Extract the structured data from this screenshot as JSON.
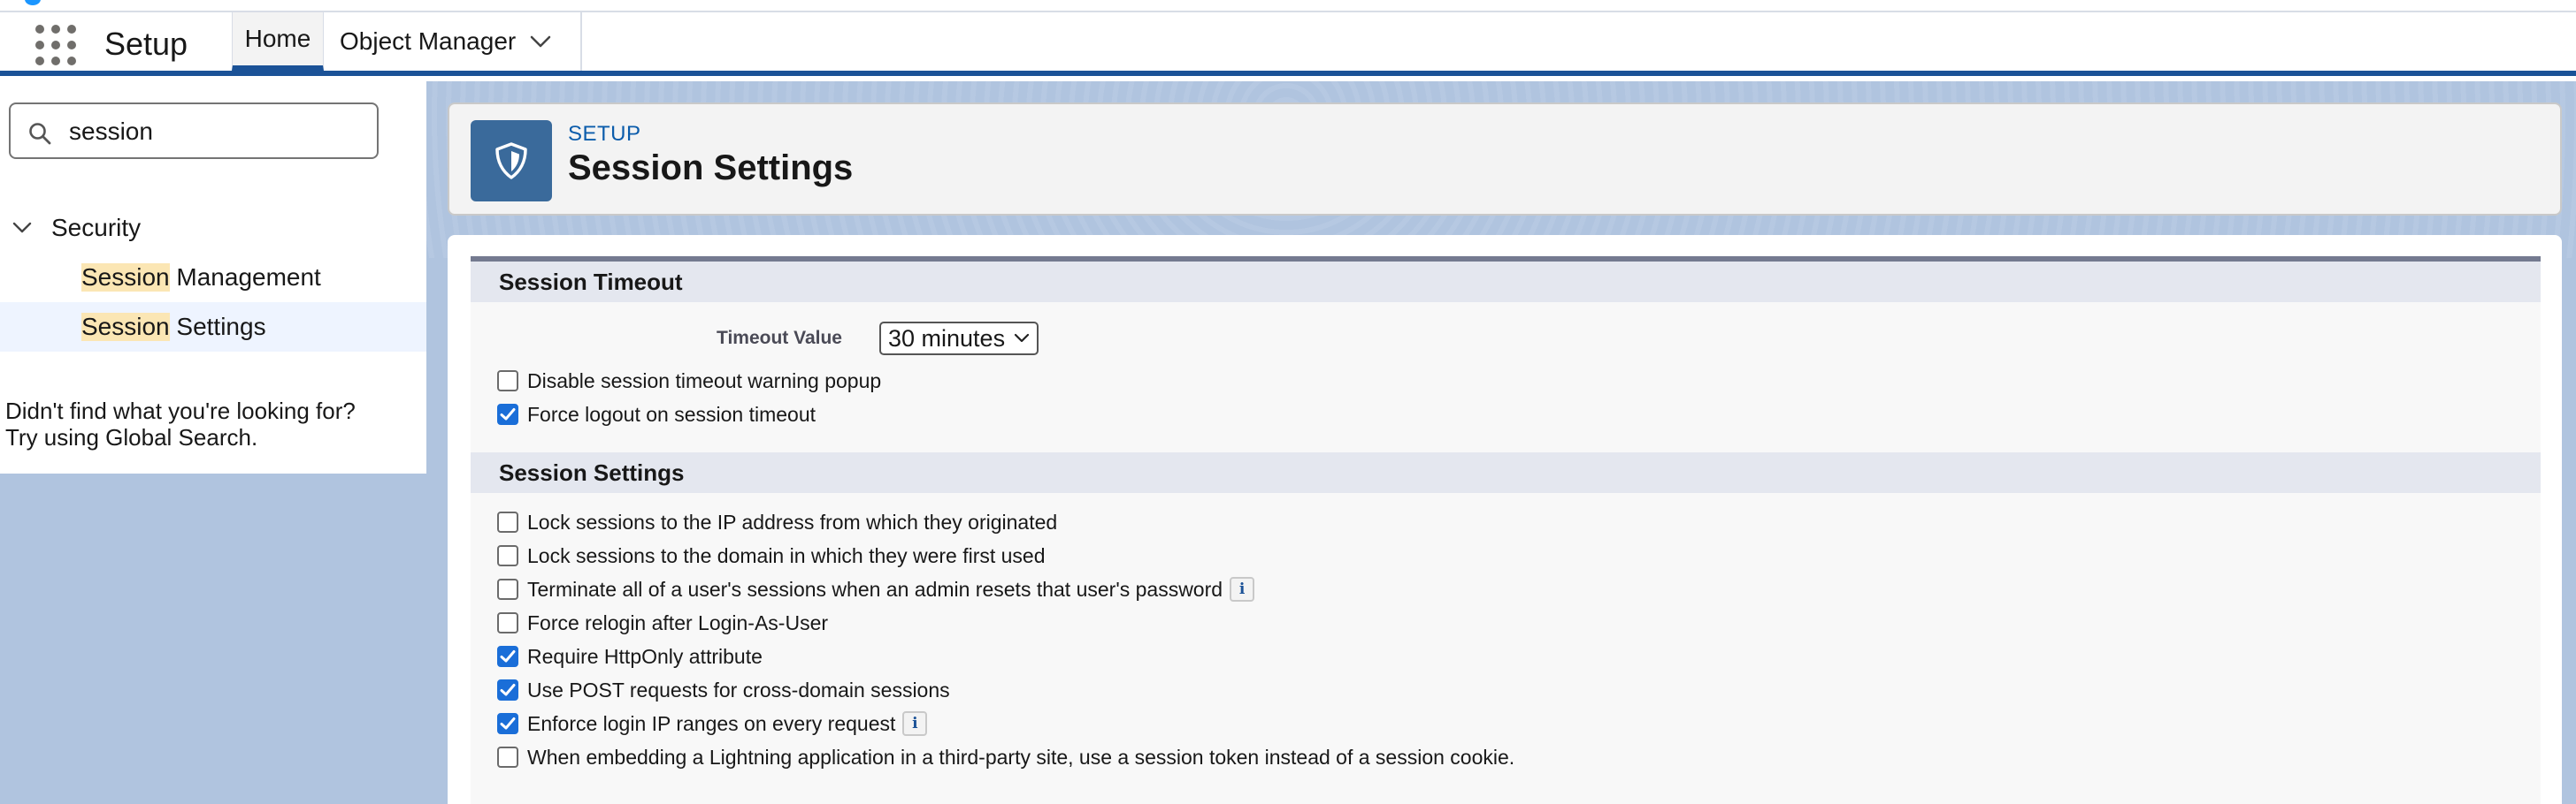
{
  "nav": {
    "app_name": "Setup",
    "tabs": [
      {
        "label": "Home"
      },
      {
        "label": "Object Manager"
      }
    ]
  },
  "sidebar": {
    "search": {
      "value": "session"
    },
    "group": {
      "label": "Security"
    },
    "items": [
      {
        "match": "Session",
        "rest": " Management"
      },
      {
        "match": "Session",
        "rest": " Settings"
      }
    ],
    "help_line1": "Didn't find what you're looking for?",
    "help_line2": "Try using Global Search."
  },
  "header": {
    "breadcrumb": "SETUP",
    "title": "Session Settings"
  },
  "session_timeout": {
    "heading": "Session Timeout",
    "timeout_label": "Timeout Value",
    "timeout_value": "30 minutes",
    "options": [
      {
        "label": "Disable session timeout warning popup",
        "checked": false
      },
      {
        "label": "Force logout on session timeout",
        "checked": true
      }
    ]
  },
  "session_settings": {
    "heading": "Session Settings",
    "options": [
      {
        "label": "Lock sessions to the IP address from which they originated",
        "checked": false,
        "info": false
      },
      {
        "label": "Lock sessions to the domain in which they were first used",
        "checked": false,
        "info": false
      },
      {
        "label": "Terminate all of a user's sessions when an admin resets that user's password",
        "checked": false,
        "info": true
      },
      {
        "label": "Force relogin after Login-As-User",
        "checked": false,
        "info": false
      },
      {
        "label": "Require HttpOnly attribute",
        "checked": true,
        "info": false
      },
      {
        "label": "Use POST requests for cross-domain sessions",
        "checked": true,
        "info": false
      },
      {
        "label": "Enforce login IP ranges on every request",
        "checked": true,
        "info": true
      },
      {
        "label": "When embedding a Lightning application in a third-party site, use a session token instead of a session cookie.",
        "checked": false,
        "info": false
      }
    ]
  },
  "icons": {
    "info_glyph": "i",
    "launcher": "app-launcher-icon",
    "search": "search-icon",
    "shield": "shield-icon"
  },
  "colors": {
    "brand_bar": "#1b5297",
    "checkbox_checked": "#1a6ed8",
    "highlight": "#fbe6b4",
    "background": "#b0c4df",
    "header_tile": "#3a6a9b"
  }
}
